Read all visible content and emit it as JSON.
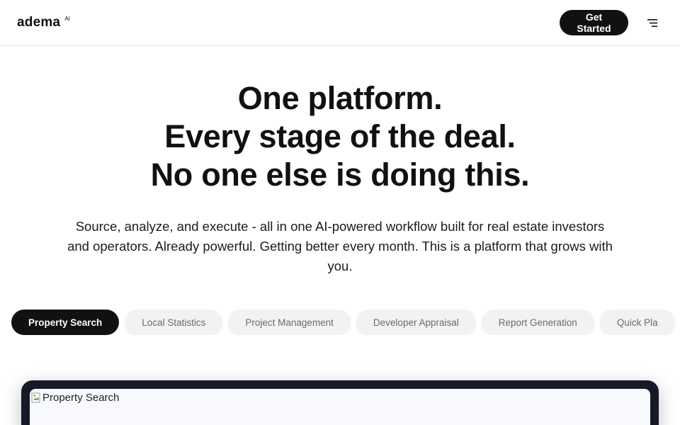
{
  "header": {
    "brand": "adema",
    "brand_badge": "AI",
    "cta_label": "Get Started",
    "menu_icon": "menu-icon"
  },
  "hero": {
    "title_lines": [
      "One platform.",
      "Every stage of the deal.",
      "No one else is doing this."
    ],
    "subtitle": "Source, analyze, and execute - all in one AI-powered workflow built for real estate investors and operators. Already powerful. Getting better every month. This is a platform that grows with you."
  },
  "tabs": [
    {
      "label": "Property Search",
      "active": true
    },
    {
      "label": "Local Statistics",
      "active": false
    },
    {
      "label": "Project Management",
      "active": false
    },
    {
      "label": "Developer Appraisal",
      "active": false
    },
    {
      "label": "Report Generation",
      "active": false
    },
    {
      "label": "Quick Pla",
      "active": false
    }
  ],
  "preview": {
    "image_alt": "Property Search"
  },
  "colors": {
    "primary": "#111111",
    "tab_bg": "#f2f2f2",
    "preview_frame": "#151a26"
  }
}
